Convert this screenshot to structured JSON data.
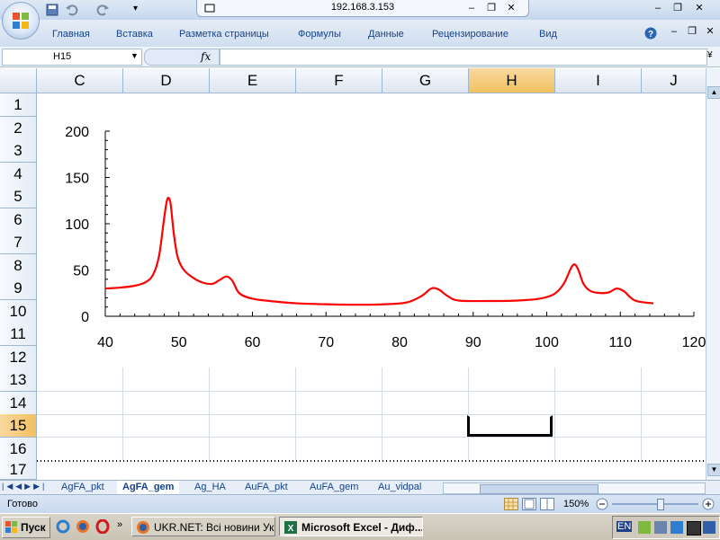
{
  "window": {
    "title": "192.168.3.153"
  },
  "ribbon": {
    "tabs": [
      "Главная",
      "Вставка",
      "Разметка страницы",
      "Формулы",
      "Данные",
      "Рецензирование",
      "Вид"
    ]
  },
  "formula_bar": {
    "name_box": "H15",
    "fx": "fx",
    "formula": ""
  },
  "columns": [
    "C",
    "D",
    "E",
    "F",
    "G",
    "H",
    "I",
    "J"
  ],
  "selected_column": "H",
  "rows": [
    "1",
    "2",
    "3",
    "4",
    "5",
    "6",
    "7",
    "8",
    "9",
    "10",
    "11",
    "12",
    "13",
    "14",
    "15",
    "16",
    "17"
  ],
  "selected_row": "15",
  "sheets": [
    "AgFA_pkt",
    "AgFA_gem",
    "Ag_HA",
    "AuFA_pkt",
    "AuFA_gem",
    "Au_vidpal"
  ],
  "active_sheet": "AgFA_gem",
  "status": {
    "ready": "Готово",
    "zoom": "150%"
  },
  "taskbar": {
    "start": "Пуск",
    "tasks": [
      "UKR.NET: Всі новини Ук...",
      "Microsoft Excel - Диф..."
    ],
    "lang": "EN"
  },
  "colors": {
    "series": "#ff0000",
    "accent": "#f1c15f"
  },
  "chart_data": {
    "type": "line",
    "title": "",
    "xlabel": "",
    "ylabel": "",
    "xlim": [
      40,
      120
    ],
    "ylim": [
      0,
      200
    ],
    "x_ticks": [
      "40",
      "50",
      "60",
      "70",
      "80",
      "90",
      "100",
      "110",
      "120"
    ],
    "y_ticks": [
      "0",
      "50",
      "100",
      "150",
      "200"
    ],
    "grid": false,
    "series": [
      {
        "x": [
          40,
          42,
          44,
          45.5,
          46.5,
          47.3,
          47.9,
          48.3,
          48.6,
          48.9,
          49.3,
          49.8,
          50.5,
          51.5,
          53,
          54.5,
          55.5,
          56.5,
          57.3,
          58.2,
          60,
          63,
          66,
          70,
          74,
          78,
          81,
          83,
          84.3,
          85.3,
          86.5,
          88,
          92,
          96,
          99,
          101,
          102.3,
          103.3,
          103.8,
          104.3,
          105,
          106,
          107.5,
          108.5,
          109.5,
          110.5,
          112,
          114.5
        ],
        "y": [
          30,
          31,
          33,
          37,
          45,
          65,
          100,
          122,
          128,
          120,
          90,
          65,
          52,
          44,
          37,
          35,
          39,
          43,
          38,
          25,
          19,
          16,
          14,
          13,
          12.5,
          13,
          15,
          22,
          30,
          29,
          22,
          17,
          16.5,
          17,
          19,
          24,
          35,
          52,
          56,
          50,
          35,
          27,
          25,
          26,
          30,
          27,
          17,
          14
        ]
      }
    ]
  }
}
